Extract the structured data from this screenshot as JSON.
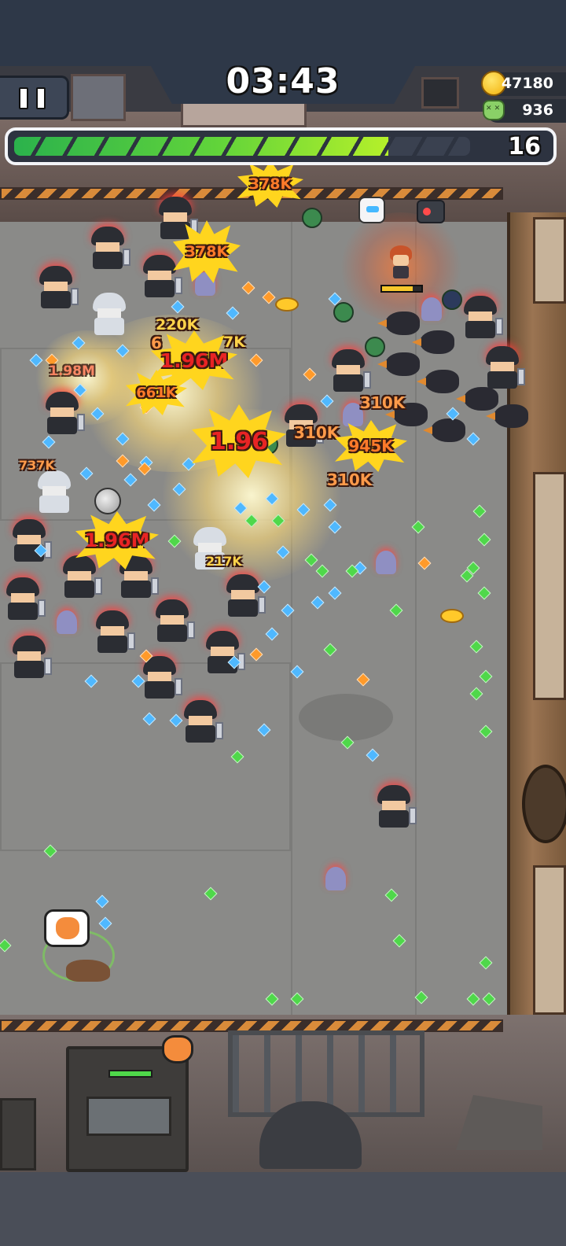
{
  "hud": {
    "timer": "03:43",
    "gold": "47180",
    "kills": "936",
    "level": "16",
    "xp_progress_fraction": 0.82,
    "player_hp_fraction": 0.78,
    "icons": {
      "pause": "pause-icon",
      "gold": "gold-coin-icon",
      "kills": "skull-icon"
    }
  },
  "damage_numbers": [
    {
      "text": "378K",
      "style": "burst"
    },
    {
      "text": "378K",
      "style": "burst"
    },
    {
      "text": "220K",
      "style": "yellow"
    },
    {
      "text": "6",
      "style": "plain"
    },
    {
      "text": "7K",
      "style": "yellow"
    },
    {
      "text": "1.96M",
      "style": "big"
    },
    {
      "text": "1.98M",
      "style": "pale"
    },
    {
      "text": "661K",
      "style": "burst"
    },
    {
      "text": "1.96",
      "style": "big"
    },
    {
      "text": "310K",
      "style": "plain"
    },
    {
      "text": "310K",
      "style": "plain"
    },
    {
      "text": "945K",
      "style": "burst"
    },
    {
      "text": "310K",
      "style": "plain"
    },
    {
      "text": "737K",
      "style": "plain"
    },
    {
      "text": "1.96M",
      "style": "big"
    },
    {
      "text": "217K",
      "style": "yellow"
    }
  ],
  "colors": {
    "gem_blue": "#4fb8ff",
    "gem_green": "#4fd84a",
    "gem_orange": "#ff9a2a",
    "xp_green": "#62d43a",
    "damage_red": "#e82424",
    "damage_burst": "#ffd51e"
  }
}
